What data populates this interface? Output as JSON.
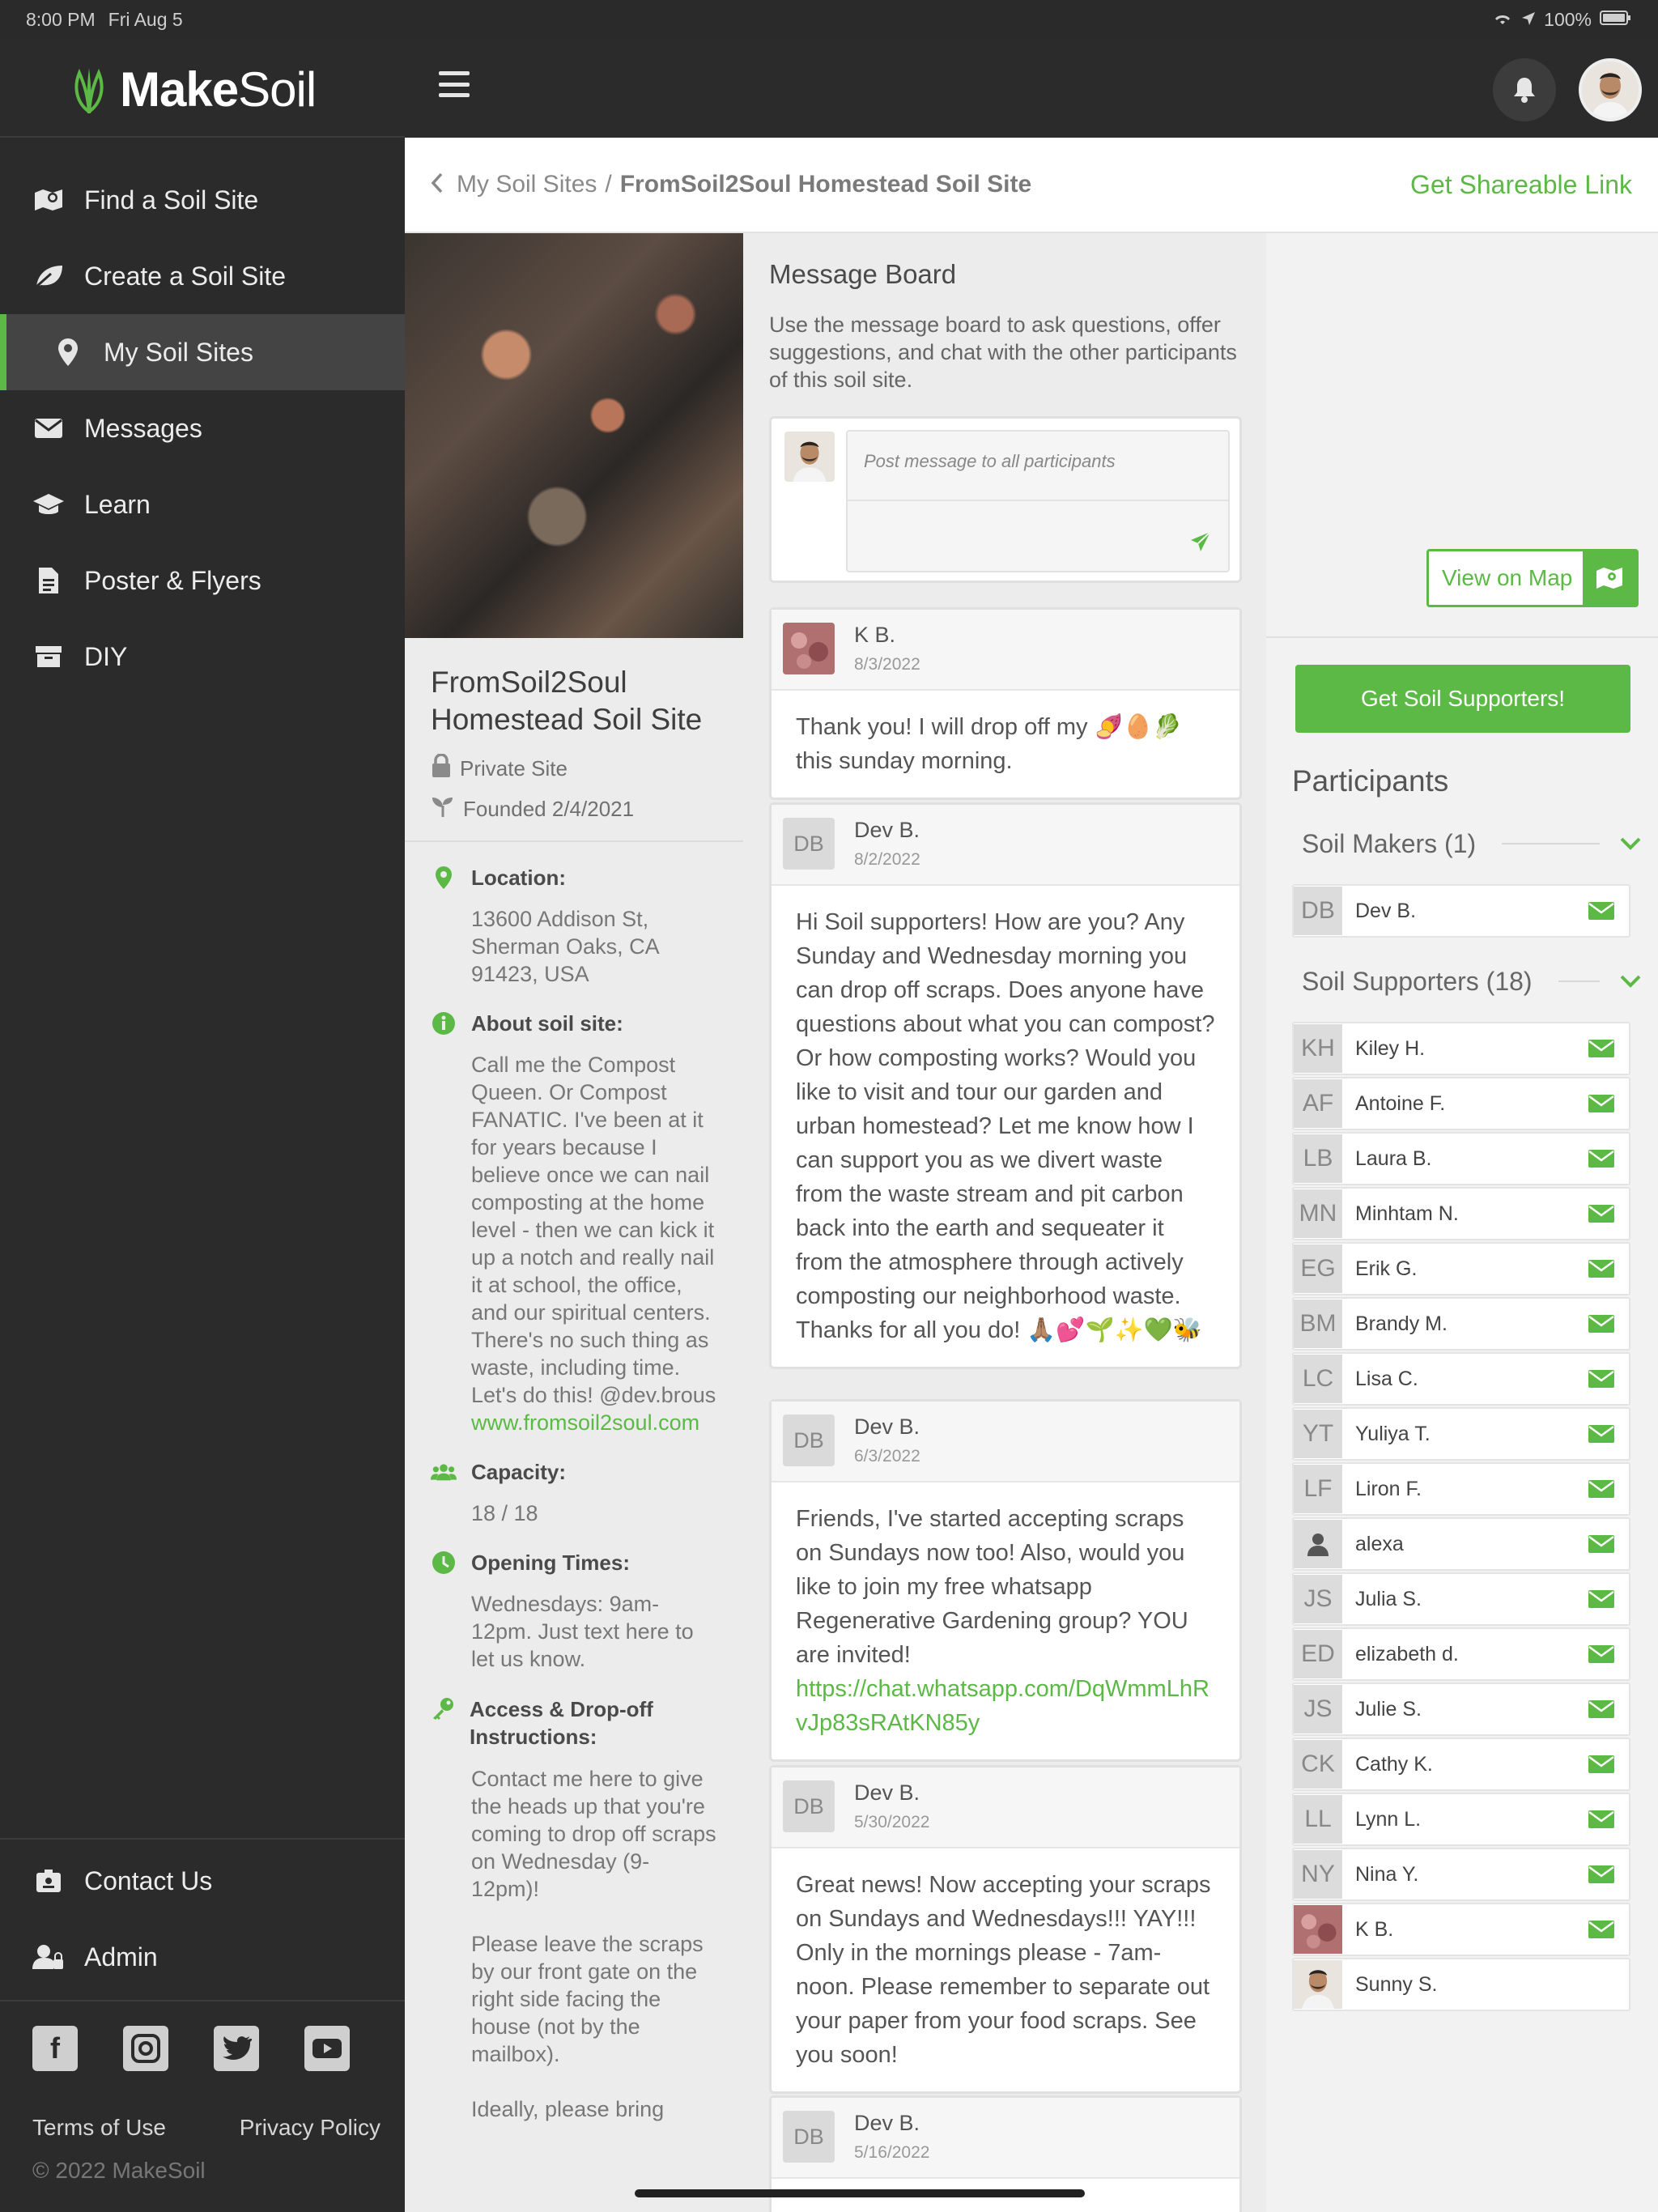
{
  "status_bar": {
    "time": "8:00 PM",
    "date": "Fri Aug 5",
    "battery": "100%"
  },
  "brand": {
    "name_bold": "Make",
    "name_light": "Soil",
    "accent": "#5cb946"
  },
  "sidebar": {
    "items": [
      {
        "label": "Find a Soil Site",
        "icon": "map-search-icon"
      },
      {
        "label": "Create a Soil Site",
        "icon": "leaf-icon"
      },
      {
        "label": "My Soil Sites",
        "icon": "map-pin-icon",
        "active": true
      },
      {
        "label": "Messages",
        "icon": "envelope-icon"
      },
      {
        "label": "Learn",
        "icon": "graduation-cap-icon"
      },
      {
        "label": "Poster & Flyers",
        "icon": "document-icon"
      },
      {
        "label": "DIY",
        "icon": "box-icon"
      }
    ],
    "bottom": [
      {
        "label": "Contact Us",
        "icon": "contact-icon"
      },
      {
        "label": "Admin",
        "icon": "user-lock-icon"
      }
    ],
    "socials": [
      "facebook-icon",
      "instagram-icon",
      "twitter-icon",
      "youtube-icon"
    ],
    "footer": {
      "terms": "Terms of Use",
      "privacy": "Privacy Policy",
      "copyright": "© 2022 MakeSoil"
    }
  },
  "breadcrumb": {
    "parent": "My Soil Sites",
    "separator": "/",
    "current": "FromSoil2Soul Homestead Soil Site",
    "share": "Get Shareable Link"
  },
  "site": {
    "title": "FromSoil2Soul Homestead Soil Site",
    "privacy": "Private Site",
    "founded": "Founded 2/4/2021",
    "location_label": "Location:",
    "location": "13600 Addison St, Sherman Oaks, CA 91423, USA",
    "about_label": "About soil site:",
    "about": "Call me the Compost Queen. Or Compost FANATIC. I've been at it for years because I believe once we can nail composting at the home level - then we can kick it up a notch and really nail it at school, the office, and our spiritual centers. There's no such thing as waste, including time. Let's do this! @dev.brous",
    "about_link": "www.fromsoil2soul.com",
    "capacity_label": "Capacity:",
    "capacity": "18 / 18",
    "hours_label": "Opening Times:",
    "hours": "Wednesdays: 9am-12pm. Just text here to let us know.",
    "access_label": "Access & Drop-off Instructions:",
    "access_1": "Contact me here to give the heads up that you're coming to drop off scraps on Wednesday (9-12pm)!",
    "access_2": "Please leave the scraps by our front gate on the right side facing the house (not by the mailbox).",
    "access_3": "Ideally, please bring"
  },
  "board": {
    "title": "Message Board",
    "description": "Use the message board to ask questions, offer suggestions, and chat with the other participants of this soil site.",
    "placeholder": "Post message to all participants",
    "messages": [
      {
        "initials": "",
        "name": "K B.",
        "date": "8/3/2022",
        "text": "Thank you! I will drop off my 🍠🥚🥬 this sunday morning."
      },
      {
        "initials": "DB",
        "name": "Dev B.",
        "date": "8/2/2022",
        "text": "Hi Soil supporters! How are you? Any Sunday and Wednesday morning you can drop off scraps. Does anyone have questions about what you can compost? Or how composting works? Would you like to visit and tour our garden and urban homestead? Let me know how I can support you as we divert waste from the waste stream and pit carbon back into the earth and sequeater it from the atmosphere through actively composting our neighborhood waste. Thanks for all you do! 🙏🏽💕🌱✨💚🐝"
      },
      {
        "initials": "DB",
        "name": "Dev B.",
        "date": "6/3/2022",
        "text": "Friends, I've started accepting scraps on Sundays now too! Also, would you like to join my free whatsapp Regenerative Gardening group? YOU are invited!",
        "link": "https://chat.whatsapp.com/DqWmmLhRvJp83sRAtKN85y"
      },
      {
        "initials": "DB",
        "name": "Dev B.",
        "date": "5/30/2022",
        "text": "Great news! Now accepting your scraps on Sundays and Wednesdays!!! YAY!!! Only in the mornings please - 7am-noon. Please remember to separate out your paper from your food scraps. See you soon!"
      },
      {
        "initials": "DB",
        "name": "Dev B.",
        "date": "5/16/2022",
        "text": ""
      }
    ]
  },
  "right": {
    "map_button": "View on Map",
    "supporters_button": "Get Soil Supporters!",
    "participants_title": "Participants",
    "makers_label": "Soil Makers (1)",
    "makers": [
      {
        "initials": "DB",
        "name": "Dev B."
      }
    ],
    "supporters_label": "Soil Supporters (18)",
    "supporters": [
      {
        "initials": "KH",
        "name": "Kiley H."
      },
      {
        "initials": "AF",
        "name": "Antoine F."
      },
      {
        "initials": "LB",
        "name": "Laura B."
      },
      {
        "initials": "MN",
        "name": "Minhtam N."
      },
      {
        "initials": "EG",
        "name": "Erik G."
      },
      {
        "initials": "BM",
        "name": "Brandy M."
      },
      {
        "initials": "LC",
        "name": "Lisa C."
      },
      {
        "initials": "YT",
        "name": "Yuliya T."
      },
      {
        "initials": "LF",
        "name": "Liron F."
      },
      {
        "initials": "",
        "name": "alexa",
        "icon": "person-icon"
      },
      {
        "initials": "JS",
        "name": "Julia S."
      },
      {
        "initials": "ED",
        "name": "elizabeth d."
      },
      {
        "initials": "JS",
        "name": "Julie S."
      },
      {
        "initials": "CK",
        "name": "Cathy K."
      },
      {
        "initials": "LL",
        "name": "Lynn L."
      },
      {
        "initials": "NY",
        "name": "Nina Y."
      },
      {
        "initials": "",
        "name": "K B.",
        "icon": "photo-avatar"
      },
      {
        "initials": "",
        "name": "Sunny S.",
        "icon": "photo-avatar",
        "no_mail": true
      }
    ]
  }
}
